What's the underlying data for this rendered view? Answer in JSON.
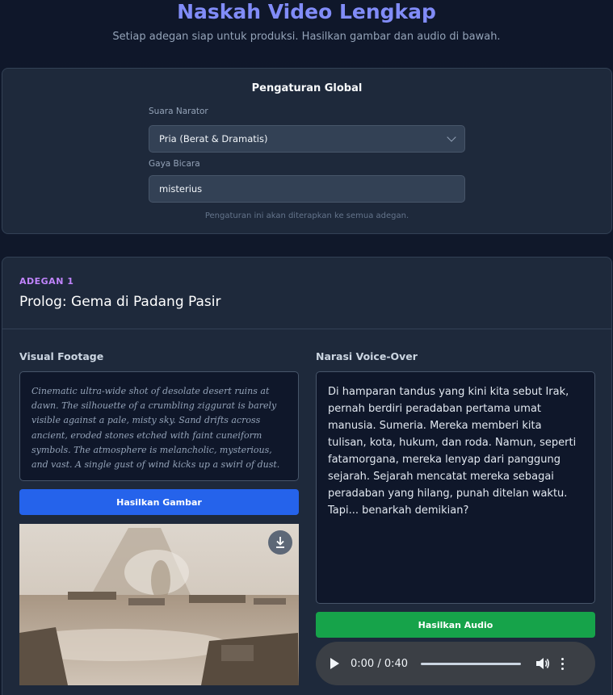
{
  "header": {
    "title": "Naskah Video Lengkap",
    "subtitle": "Setiap adegan siap untuk produksi. Hasilkan gambar dan audio di bawah."
  },
  "global_settings": {
    "title": "Pengaturan Global",
    "narrator_label": "Suara Narator",
    "narrator_value": "Pria (Berat & Dramatis)",
    "style_label": "Gaya Bicara",
    "style_value": "misterius",
    "note": "Pengaturan ini akan diterapkan ke semua adegan."
  },
  "scene": {
    "kicker": "ADEGAN 1",
    "title": "Prolog: Gema di Padang Pasir",
    "visual_label": "Visual Footage",
    "visual_prompt": "Cinematic ultra-wide shot of desolate desert ruins at dawn. The silhouette of a crumbling ziggurat is barely visible against a pale, misty sky. Sand drifts across ancient, eroded stones etched with faint cuneiform symbols. The atmosphere is melancholic, mysterious, and vast. A single gust of wind kicks up a swirl of dust.",
    "generate_image_label": "Hasilkan Gambar",
    "narration_label": "Narasi Voice-Over",
    "narration_text": "Di hamparan tandus yang kini kita sebut Irak, pernah berdiri peradaban pertama umat manusia. Sumeria. Mereka memberi kita tulisan, kota, hukum, dan roda. Namun, seperti fatamorgana, mereka lenyap dari panggung sejarah. Sejarah mencatat mereka sebagai peradaban yang hilang, punah ditelan waktu. Tapi... benarkah demikian?",
    "generate_audio_label": "Hasilkan Audio",
    "audio_time": "0:00 / 0:40"
  },
  "icons": {
    "download": "download-icon",
    "play": "play-icon",
    "volume": "volume-icon",
    "more": "more-vertical-icon",
    "chevron": "chevron-down-icon"
  },
  "colors": {
    "accent_title": "#818cf8",
    "scene_kicker": "#c084fc",
    "image_button": "#2563eb",
    "audio_button": "#16a34a"
  }
}
